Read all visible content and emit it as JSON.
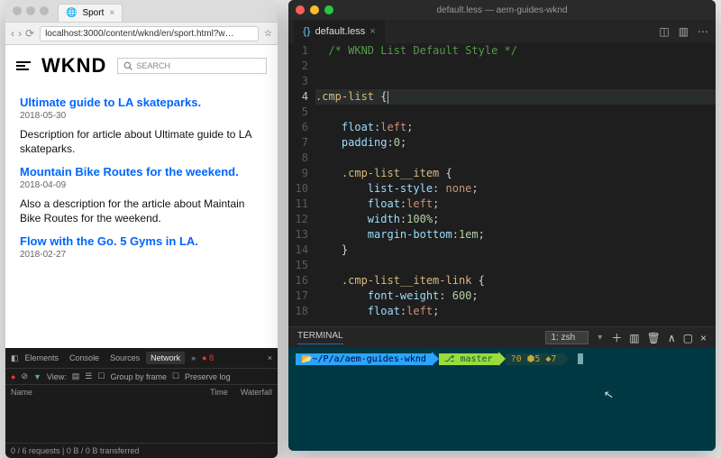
{
  "browser": {
    "tab_title": "Sport",
    "url": "localhost:3000/content/wknd/en/sport.html?w…",
    "brand": "WKND",
    "search_placeholder": "SEARCH",
    "articles": [
      {
        "title": "Ultimate guide to LA skateparks.",
        "date": "2018-05-30",
        "desc": "Description for article about Ultimate guide to LA skateparks."
      },
      {
        "title": "Mountain Bike Routes for the weekend.",
        "date": "2018-04-09",
        "desc": "Also a description for the article about Maintain Bike Routes for the weekend."
      },
      {
        "title": "Flow with the Go. 5 Gyms in LA.",
        "date": "2018-02-27",
        "desc": ""
      }
    ]
  },
  "devtools": {
    "tabs": [
      "Elements",
      "Console",
      "Sources",
      "Network"
    ],
    "active_tab": "Network",
    "extra": "»",
    "badge": "8",
    "filters": {
      "view": "View:",
      "group": "Group by frame",
      "preserve": "Preserve log"
    },
    "cols": [
      "Name",
      "Time",
      "Waterfall"
    ],
    "status": "0 / 6 requests | 0 B / 0 B transferred"
  },
  "editor": {
    "window_title": "default.less — aem-guides-wknd",
    "tab": "default.less",
    "code_lines": [
      {
        "n": 1,
        "html": "  <span class='tok-cmt'>/* WKND List Default Style */</span>"
      },
      {
        "n": 2,
        "html": ""
      },
      {
        "n": 3,
        "html": ""
      },
      {
        "n": 4,
        "html": "<span class='tok-sel'>.cmp-list</span> <span class='tok-br'>{</span><span class='caret'></span>",
        "cur": true
      },
      {
        "n": 5,
        "html": ""
      },
      {
        "n": 6,
        "html": "    <span class='tok-prop'>float</span>:<span class='tok-val'>left</span>;"
      },
      {
        "n": 7,
        "html": "    <span class='tok-prop'>padding</span>:<span class='tok-num'>0</span>;"
      },
      {
        "n": 8,
        "html": ""
      },
      {
        "n": 9,
        "html": "    <span class='tok-sel'>.cmp-list__item</span> <span class='tok-br'>{</span>"
      },
      {
        "n": 10,
        "html": "        <span class='tok-prop'>list-style</span>: <span class='tok-val'>none</span>;"
      },
      {
        "n": 11,
        "html": "        <span class='tok-prop'>float</span>:<span class='tok-val'>left</span>;"
      },
      {
        "n": 12,
        "html": "        <span class='tok-prop'>width</span>:<span class='tok-num'>100%</span>;"
      },
      {
        "n": 13,
        "html": "        <span class='tok-prop'>margin-bottom</span>:<span class='tok-num'>1em</span>;"
      },
      {
        "n": 14,
        "html": "    <span class='tok-br'>}</span>"
      },
      {
        "n": 15,
        "html": ""
      },
      {
        "n": 16,
        "html": "    <span class='tok-sel'>.cmp-list__item-link</span> <span class='tok-br'>{</span>"
      },
      {
        "n": 17,
        "html": "        <span class='tok-prop'>font-weight</span>: <span class='tok-num'>600</span>;"
      },
      {
        "n": 18,
        "html": "        <span class='tok-prop'>float</span>:<span class='tok-val'>left</span>;"
      }
    ],
    "terminal": {
      "label": "TERMINAL",
      "select": "1: zsh",
      "prompt_path": "~/P/a/aem-guides-wknd",
      "prompt_branch": "master",
      "prompt_stats": "?0 ⬢5 ◆7"
    }
  }
}
